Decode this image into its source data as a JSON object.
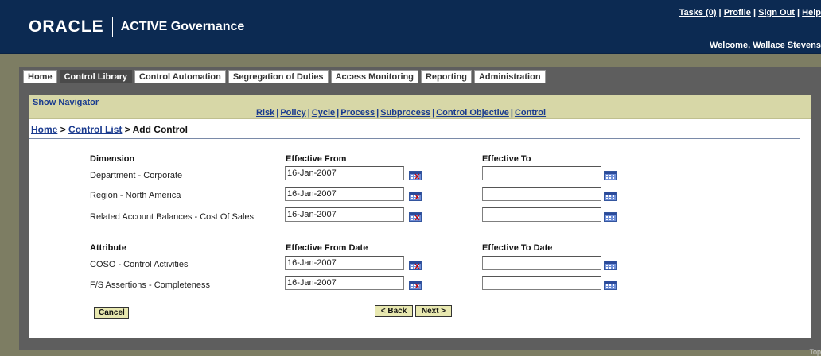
{
  "header": {
    "brand": "ORACLE",
    "product": "ACTIVE Governance",
    "links": [
      "Tasks (0)",
      "Profile",
      "Sign Out",
      "Help"
    ],
    "welcome": "Welcome, Wallace Stevens"
  },
  "tabs": [
    {
      "label": "Home",
      "active": false
    },
    {
      "label": "Control Library",
      "active": true
    },
    {
      "label": "Control Automation",
      "active": false
    },
    {
      "label": "Segregation of Duties",
      "active": false
    },
    {
      "label": "Access Monitoring",
      "active": false
    },
    {
      "label": "Reporting",
      "active": false
    },
    {
      "label": "Administration",
      "active": false
    }
  ],
  "navbar": {
    "show_navigator": "Show Navigator",
    "dimension_links": [
      "Risk",
      "Policy",
      "Cycle",
      "Process",
      "Subprocess",
      "Control Objective",
      "Control"
    ]
  },
  "breadcrumb": {
    "home": "Home",
    "sep1": ">",
    "control_list": "Control List",
    "current": "> Add Control"
  },
  "dimensions": {
    "col_name": "Dimension",
    "col_from": "Effective From",
    "col_to": "Effective To",
    "rows": [
      {
        "name": "Department - Corporate",
        "from": "16-Jan-2007",
        "to": ""
      },
      {
        "name": "Region - North America",
        "from": "16-Jan-2007",
        "to": ""
      },
      {
        "name": "Related Account Balances - Cost Of Sales",
        "from": "16-Jan-2007",
        "to": ""
      }
    ]
  },
  "attributes": {
    "col_name": "Attribute",
    "col_from": "Effective From Date",
    "col_to": "Effective To Date",
    "rows": [
      {
        "name": "COSO - Control Activities",
        "from": "16-Jan-2007",
        "to": ""
      },
      {
        "name": "F/S Assertions - Completeness",
        "from": "16-Jan-2007",
        "to": ""
      }
    ]
  },
  "buttons": {
    "cancel": "Cancel",
    "back": "< Back",
    "next": "Next >"
  },
  "footer": {
    "top": "Top"
  },
  "colors": {
    "header_bg": "#0c2a52",
    "frame_bg": "#7d7d63",
    "navbar_bg": "#d7d7a7",
    "link": "#1a3b8f",
    "button_bg": "#e8e8b0"
  }
}
